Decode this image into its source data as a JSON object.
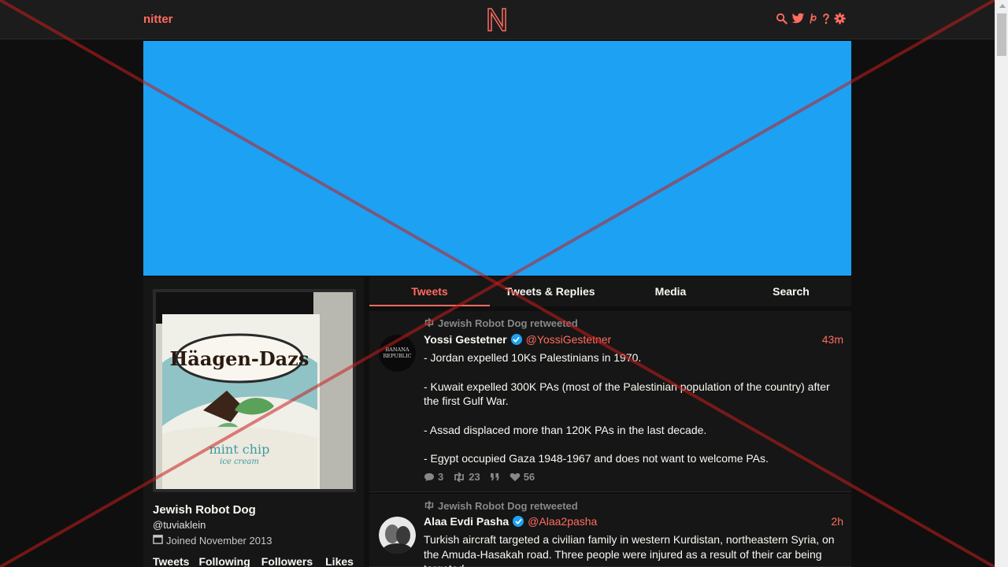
{
  "navbar": {
    "brand": "nitter",
    "logo_letter": "N",
    "icons": [
      "search-icon",
      "twitter-icon",
      "rss-icon",
      "help-icon",
      "settings-icon"
    ]
  },
  "colors": {
    "accent": "#ff6c60",
    "banner": "#1da1f2",
    "background": "#0f0f0f",
    "panel": "#161616"
  },
  "profile": {
    "fullname": "Jewish Robot Dog",
    "username": "@tuviaklein",
    "joined": "Joined November 2013",
    "avatar_brand": "Häagen-Dazs",
    "avatar_flavor": "mint chip",
    "avatar_sub": "ice cream",
    "stats": [
      "Tweets",
      "Following",
      "Followers",
      "Likes"
    ]
  },
  "tabs": [
    {
      "label": "Tweets",
      "active": true
    },
    {
      "label": "Tweets & Replies",
      "active": false
    },
    {
      "label": "Media",
      "active": false
    },
    {
      "label": "Search",
      "active": false
    }
  ],
  "tweets": [
    {
      "retweet_label": "Jewish Robot Dog retweeted",
      "fullname": "Yossi Gestetner",
      "handle": "@YossiGestetner",
      "date": "43m",
      "avatar_text": "BANANA REPUBLIC",
      "paragraphs": [
        "- Jordan expelled 10Ks Palestinians in 1970.",
        "- Kuwait expelled 300K PAs (most of the Palestinian population of the country) after the first Gulf War.",
        "- Assad displaced more than 120K PAs in the last decade.",
        "- Egypt occupied Gaza 1948-1967 and does not want to welcome PAs."
      ],
      "replies": "3",
      "retweets": "23",
      "quotes": "",
      "likes": "56"
    },
    {
      "retweet_label": "Jewish Robot Dog retweeted",
      "fullname": "Alaa Evdi Pasha",
      "handle": "@Alaa2pasha",
      "date": "2h",
      "paragraphs": [
        "Turkish aircraft targeted a civilian family in western Kurdistan, northeastern Syria, on the Amuda-Hasakah road. Three people were injured as a result of their car being targeted."
      ]
    }
  ]
}
